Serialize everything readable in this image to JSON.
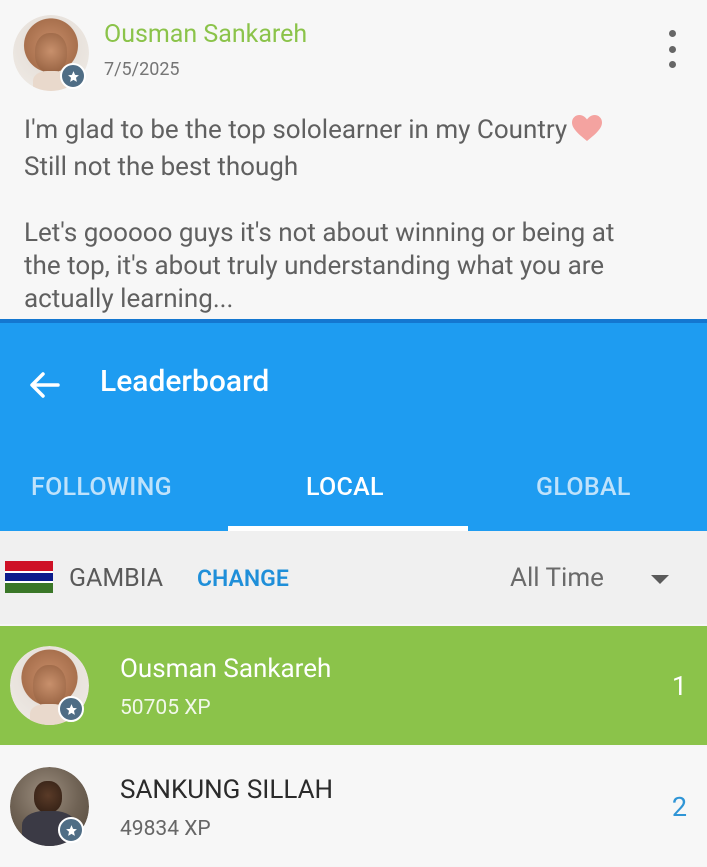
{
  "post": {
    "author": "Ousman Sankareh",
    "date": "7/5/2025",
    "line1": "I'm glad to be the top sololearner in my Country",
    "line2": "Still not the best though",
    "line3": "Let's gooooo guys it's not about winning or being at",
    "line4": "the top, it's about truly understanding what you are",
    "line5": "actually learning...",
    "heart_emoji": "heart-icon"
  },
  "leaderboard": {
    "title": "Leaderboard",
    "tabs": {
      "following": "FOLLOWING",
      "local": "LOCAL",
      "global": "GLOBAL"
    },
    "active_tab": "LOCAL",
    "country": "GAMBIA",
    "change_label": "CHANGE",
    "time_filter": "All Time",
    "entries": [
      {
        "name": "Ousman Sankareh",
        "xp": "50705 XP",
        "rank": "1",
        "highlighted": true
      },
      {
        "name": "SANKUNG SILLAH",
        "xp": "49834 XP",
        "rank": "2",
        "highlighted": false
      }
    ]
  },
  "colors": {
    "author_green": "#8bc34a",
    "appbar_blue": "#1e9cf1",
    "highlight_row": "#8bc34a",
    "change_link": "#1f8fd9",
    "badge": "#4f6d85"
  }
}
